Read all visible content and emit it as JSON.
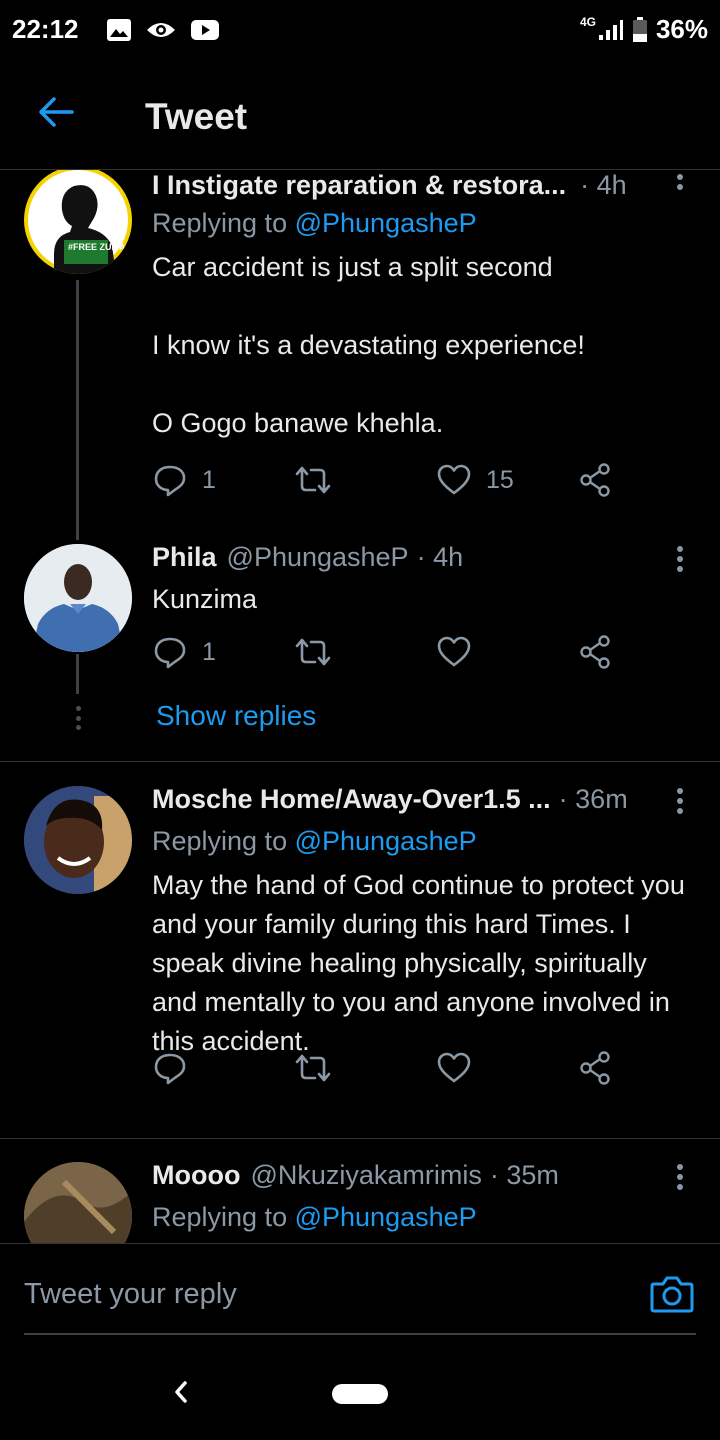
{
  "status_bar": {
    "time": "22:12",
    "network": "4G",
    "battery": "36%",
    "icons": [
      "gallery-icon",
      "eye-icon",
      "youtube-icon",
      "signal-icon",
      "battery-icon"
    ]
  },
  "header": {
    "title": "Tweet",
    "back_icon": "arrow-left-icon"
  },
  "tweets": [
    {
      "name": "I Instigate reparation & restora...",
      "handle": "",
      "time": "· 4h",
      "replying_prefix": "Replying to",
      "replying_to": "@PhungasheP",
      "body": [
        "Car accident is just a split second",
        "I know it's a devastating experience!",
        "O Gogo banawe khehla."
      ],
      "avatar_text": "#FREE ZUMA",
      "replies": "1",
      "retweets": "",
      "likes": "15"
    },
    {
      "name": "Phila",
      "handle": "@PhungasheP",
      "time": "· 4h",
      "body": [
        "Kunzima"
      ],
      "replies": "1",
      "retweets": "",
      "likes": ""
    },
    {
      "name": "Mosche Home/Away-Over1.5 ...",
      "handle": "",
      "time": "· 36m",
      "replying_prefix": "Replying to",
      "replying_to": "@PhungasheP",
      "body": [
        "May the hand of God continue to protect you and your family during this hard Times. I speak divine healing physically, spiritually and mentally to you and anyone involved in this accident."
      ],
      "replies": "",
      "retweets": "",
      "likes": ""
    },
    {
      "name": "Moooo",
      "handle": "@Nkuziyakamrimis",
      "time": "· 35m",
      "replying_prefix": "Replying to",
      "replying_to": "@PhungasheP"
    }
  ],
  "show_replies": "Show replies",
  "compose": {
    "placeholder": "Tweet your reply",
    "camera_icon": "camera-icon"
  },
  "colors": {
    "background": "#000000",
    "accent": "#1d9bf0",
    "text_primary": "#e7e9ea",
    "text_secondary": "#8b98a5",
    "divider": "#2f3336"
  }
}
